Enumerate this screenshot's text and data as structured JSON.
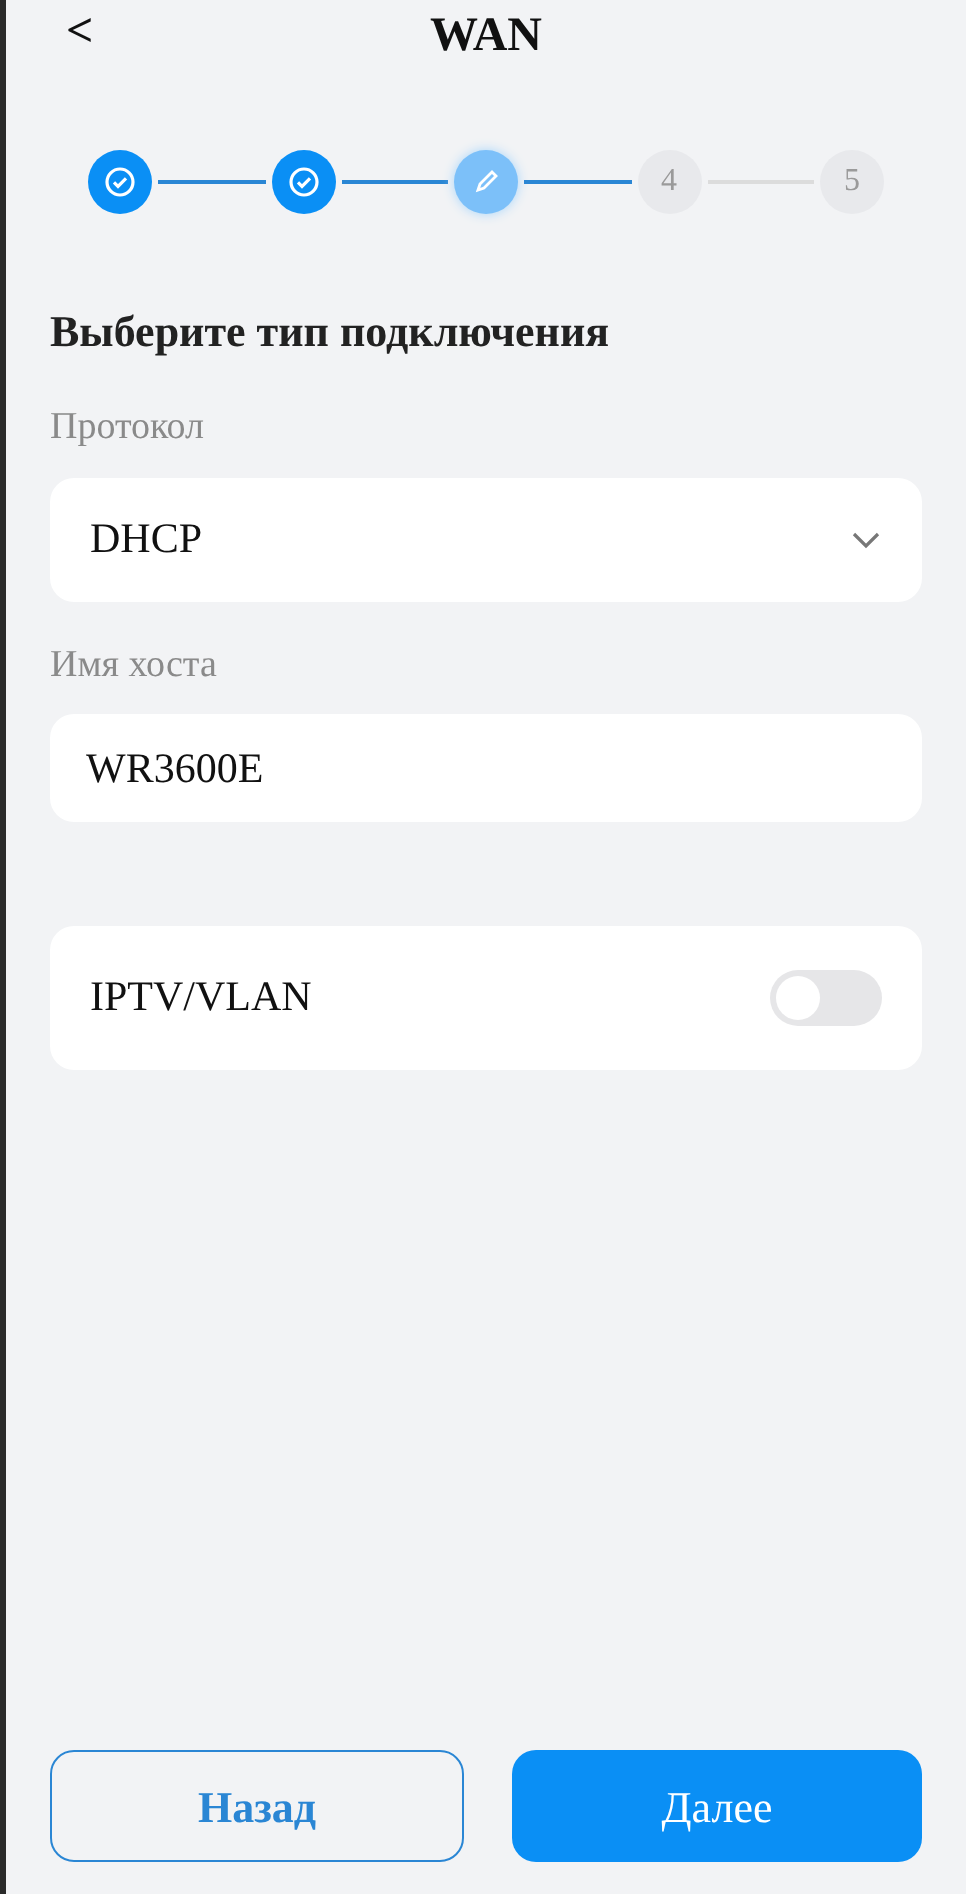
{
  "header": {
    "back": "<",
    "title": "WAN"
  },
  "steps": [
    {
      "kind": "done"
    },
    {
      "kind": "done"
    },
    {
      "kind": "current"
    },
    {
      "kind": "todo",
      "label": "4"
    },
    {
      "kind": "todo",
      "label": "5"
    }
  ],
  "heading": "Выберите тип подключения",
  "protocol": {
    "label": "Протокол",
    "value": "DHCP"
  },
  "hostname": {
    "label": "Имя хоста",
    "value": "WR3600E"
  },
  "iptv": {
    "label": "IPTV/VLAN",
    "on": false
  },
  "buttons": {
    "back": "Назад",
    "next": "Далее"
  }
}
